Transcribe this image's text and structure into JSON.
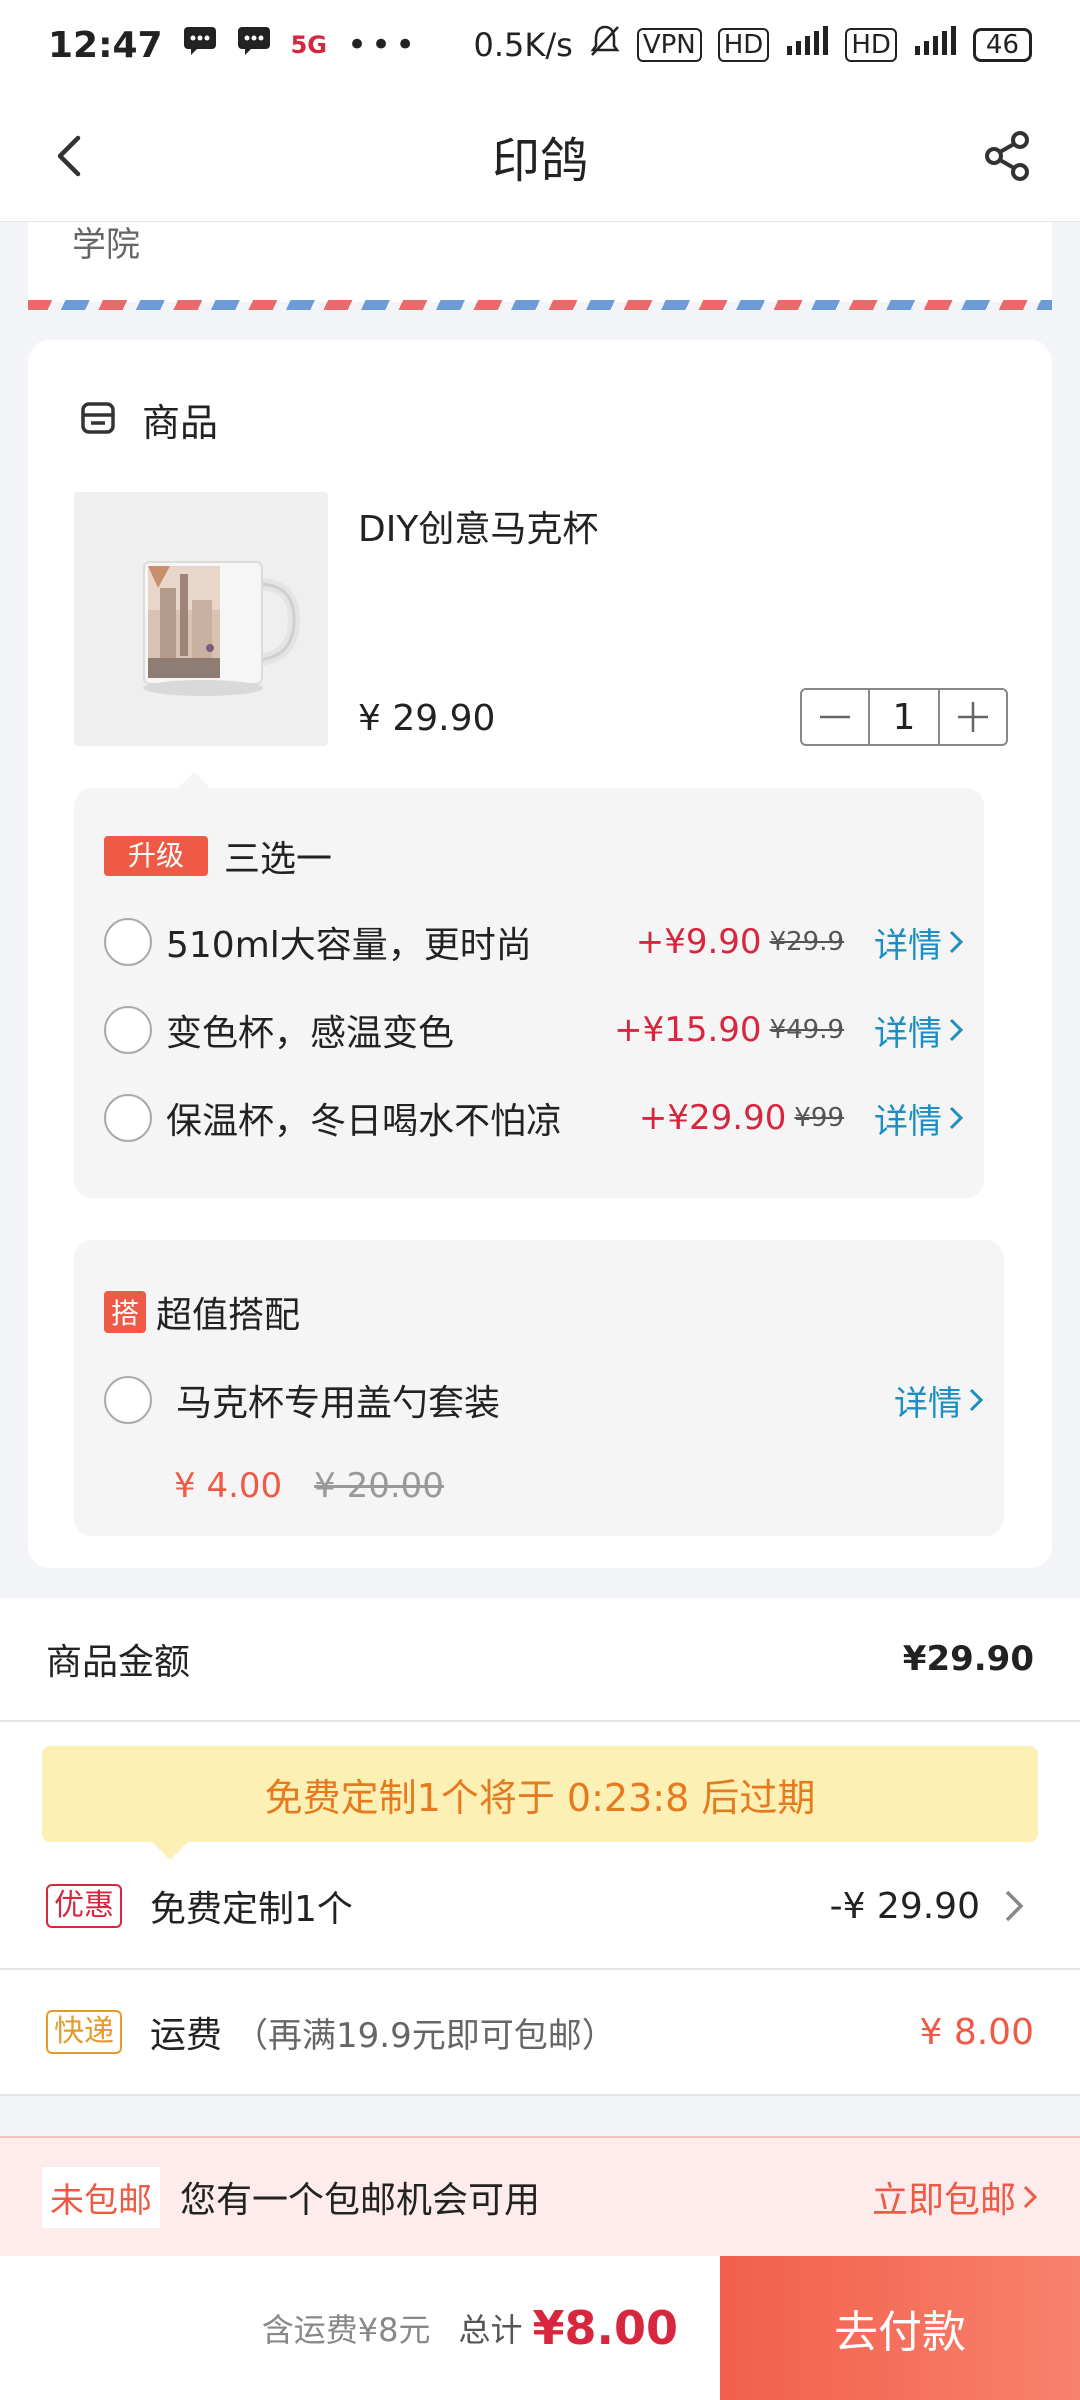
{
  "status_bar": {
    "time": "12:47",
    "network_speed": "0.5K/s",
    "vpn": "VPN",
    "hd1": "HD",
    "hd2": "HD",
    "battery": "46"
  },
  "nav": {
    "title": "印鸽",
    "back_icon": "chevron-left-icon",
    "share_icon": "share-icon"
  },
  "address": {
    "partial_text": "学院"
  },
  "goods": {
    "section_title": "商品",
    "product": {
      "name": "DIY创意马克杯",
      "price": "¥ 29.90",
      "quantity": "1"
    },
    "upgrade": {
      "tag": "升级",
      "title": "三选一",
      "options": [
        {
          "label": "510ml大容量，更时尚",
          "price": "+¥9.90",
          "orig": "¥29.9",
          "detail": "详情"
        },
        {
          "label": "变色杯，感温变色",
          "price": "+¥15.90",
          "orig": "¥49.9",
          "detail": "详情"
        },
        {
          "label": "保温杯，冬日喝水不怕凉",
          "price": "+¥29.90",
          "orig": "¥99",
          "detail": "详情"
        }
      ]
    },
    "combo": {
      "tag": "搭",
      "title": "超值搭配",
      "item_label": "马克杯专用盖勺套装",
      "detail": "详情",
      "price": "¥ 4.00",
      "orig": "¥ 20.00"
    }
  },
  "summary": {
    "goods_amount_label": "商品金额",
    "goods_amount_value": "¥29.90",
    "expire_banner": "免费定制1个将于 0:23:8 后过期",
    "coupon_tag": "优惠",
    "coupon_label": "免费定制1个",
    "coupon_value": "-¥ 29.90",
    "express_tag": "快递",
    "shipping_label": "运费",
    "shipping_note": "（再满19.9元即可包邮）",
    "shipping_value": "¥ 8.00"
  },
  "free_shipping": {
    "tag": "未包邮",
    "text": "您有一个包邮机会可用",
    "action": "立即包邮"
  },
  "footer": {
    "shipping_included": "含运费¥8元",
    "total_label": "总计",
    "total_value": "¥8.00",
    "pay_button": "去付款"
  },
  "colors": {
    "accent": "#ee5a45",
    "price_red": "#d7263d",
    "link_blue": "#1b8fc4",
    "banner_yellow": "#fdf0b4"
  }
}
